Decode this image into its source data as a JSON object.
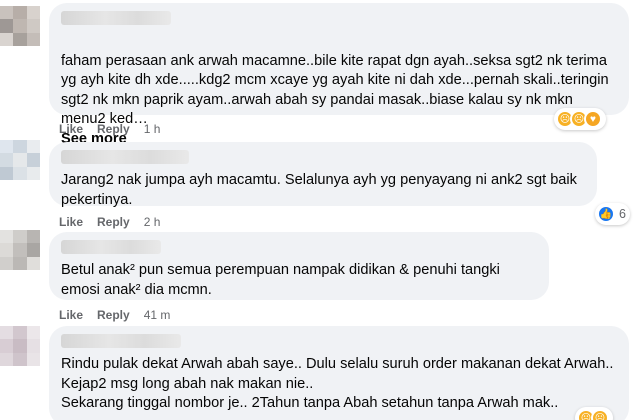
{
  "comments": [
    {
      "text": "faham perasaan ank arwah macamne..bile kite rapat dgn ayah..seksa sgt2 nk terima yg ayh kite dh xde.....kdg2 mcm xcaye yg ayah kite ni dah xde...pernah skali..teringin sgt2 nk mkn paprik ayam..arwah abah sy pandai masak..biase kalau sy nk mkn menu2 ked…",
      "see_more": "See more",
      "like": "Like",
      "reply": "Reply",
      "time": "1 h",
      "reactions": [
        "sad-face-icon",
        "sad-face-icon",
        "care-hug-icon"
      ],
      "reaction_count": ""
    },
    {
      "text": "Jarang2 nak jumpa ayh macamtu. Selalunya ayh yg penyayang ni ank2 sgt baik pekertinya.",
      "like": "Like",
      "reply": "Reply",
      "time": "2 h",
      "reactions": [
        "like-thumb-icon"
      ],
      "reaction_count": "6"
    },
    {
      "text": "Betul anak² pun semua perempuan nampak didikan & penuhi tangki emosi anak² dia mcmn.",
      "like": "Like",
      "reply": "Reply",
      "time": "41 m"
    },
    {
      "text": "Rindu pulak dekat Arwah abah saye.. Dulu selalu suruh order makanan dekat Arwah..\nKejap2 msg long abah nak makan nie..\nSekarang tinggal nombor je.. 2Tahun tanpa Abah setahun tanpa Arwah mak..",
      "reactions": [
        "sad-face-icon",
        "sad-face-icon"
      ],
      "reaction_count": ""
    }
  ],
  "colors": {
    "bubble_bg": "#f0f2f5",
    "meta_text": "#65676b",
    "like_blue": "#1877f2",
    "emoji_yellow": "#f7b125"
  }
}
